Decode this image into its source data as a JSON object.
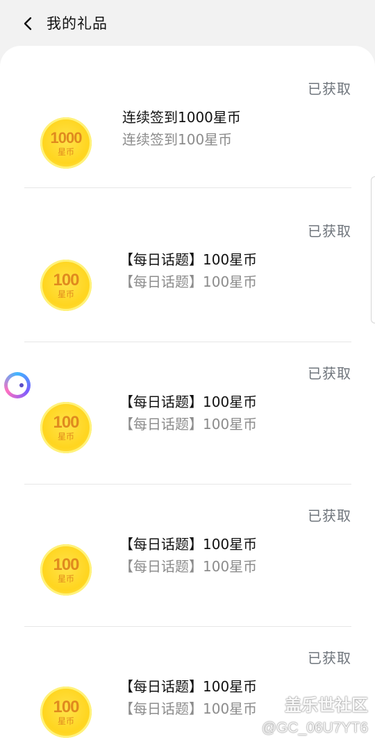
{
  "header": {
    "back_icon": "chevron-left-icon",
    "title": "我的礼品"
  },
  "gifts": [
    {
      "status": "已获取",
      "coin_amount": "1000",
      "coin_unit": "星币",
      "title": "连续签到1000星币",
      "subtitle": "连续签到100星币"
    },
    {
      "status": "已获取",
      "coin_amount": "100",
      "coin_unit": "星币",
      "title": "【每日话题】100星币",
      "subtitle": "【每日话题】100星币"
    },
    {
      "status": "已获取",
      "coin_amount": "100",
      "coin_unit": "星币",
      "title": "【每日话题】100星币",
      "subtitle": "【每日话题】100星币"
    },
    {
      "status": "已获取",
      "coin_amount": "100",
      "coin_unit": "星币",
      "title": "【每日话题】100星币",
      "subtitle": "【每日话题】100星币"
    },
    {
      "status": "已获取",
      "coin_amount": "100",
      "coin_unit": "星币",
      "title": "【每日话题】100星币",
      "subtitle": "【每日话题】100星币"
    }
  ],
  "floating_button": {
    "icon": "assistant-ball-icon"
  },
  "watermark": {
    "name": "盖乐世社区",
    "user": "@GC_06U7YT6"
  },
  "colors": {
    "background": "#f2f2f2",
    "card": "#ffffff",
    "status_text": "#6f757c",
    "coin_gold": "#ffd51f",
    "coin_text": "#e08a1e"
  }
}
